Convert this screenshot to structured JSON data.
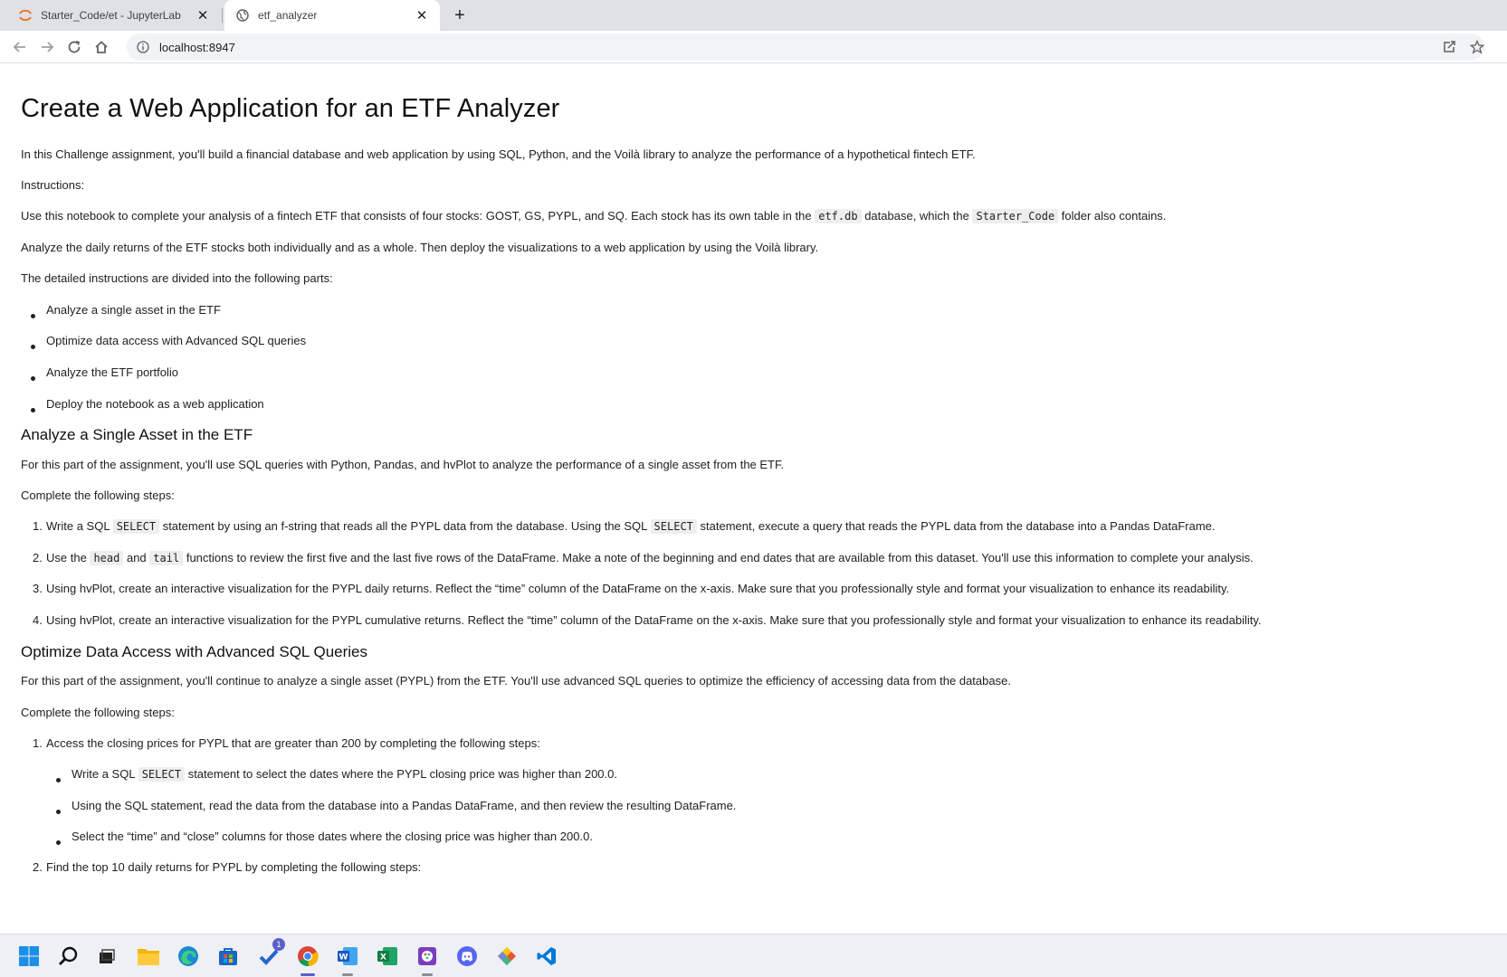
{
  "browser": {
    "tabs": [
      {
        "title": "Starter_Code/et - JupyterLab",
        "active": false,
        "icon": "jupyter-icon"
      },
      {
        "title": "etf_analyzer",
        "active": true,
        "icon": "globe-icon"
      }
    ],
    "url": "localhost:8947"
  },
  "doc": {
    "title": "Create a Web Application for an ETF Analyzer",
    "intro": "In this Challenge assignment, you'll build a financial database and web application by using SQL, Python, and the Voilà library to analyze the performance of a hypothetical fintech ETF.",
    "instructions_label": "Instructions:",
    "use_notebook": {
      "before": "Use this notebook to complete your analysis of a fintech ETF that consists of four stocks: GOST, GS, PYPL, and SQ. Each stock has its own table in the",
      "code1": "etf.db",
      "middle": "database, which the",
      "code2": "Starter_Code",
      "after": "folder also contains."
    },
    "analyze_daily": "Analyze the daily returns of the ETF stocks both individually and as a whole. Then deploy the visualizations to a web application by using the Voilà library.",
    "parts_label": "The detailed instructions are divided into the following parts:",
    "parts": [
      "Analyze a single asset in the ETF",
      "Optimize data access with Advanced SQL queries",
      "Analyze the ETF portfolio",
      "Deploy the notebook as a web application"
    ],
    "section1": {
      "heading": "Analyze a Single Asset in the ETF",
      "intro": "For this part of the assignment, you'll use SQL queries with Python, Pandas, and hvPlot to analyze the performance of a single asset from the ETF.",
      "steps_label": "Complete the following steps:",
      "step1": {
        "num": "1.",
        "a": "Write a SQL",
        "code1": "SELECT",
        "b": "statement by using an f-string that reads all the PYPL data from the database. Using the SQL",
        "code2": "SELECT",
        "c": "statement, execute a query that reads the PYPL data from the database into a Pandas DataFrame."
      },
      "step2": {
        "num": "2.",
        "a": "Use the",
        "code1": "head",
        "b": "and",
        "code2": "tail",
        "c": "functions to review the first five and the last five rows of the DataFrame. Make a note of the beginning and end dates that are available from this dataset. You'll use this information to complete your analysis."
      },
      "step3": {
        "num": "3.",
        "text": "Using hvPlot, create an interactive visualization for the PYPL daily returns. Reflect the “time” column of the DataFrame on the x-axis. Make sure that you professionally style and format your visualization to enhance its readability."
      },
      "step4": {
        "num": "4.",
        "text": "Using hvPlot, create an interactive visualization for the PYPL cumulative returns. Reflect the “time” column of the DataFrame on the x-axis. Make sure that you professionally style and format your visualization to enhance its readability."
      }
    },
    "section2": {
      "heading": "Optimize Data Access with Advanced SQL Queries",
      "intro": "For this part of the assignment, you'll continue to analyze a single asset (PYPL) from the ETF. You'll use advanced SQL queries to optimize the efficiency of accessing data from the database.",
      "steps_label": "Complete the following steps:",
      "step1": {
        "num": "1.",
        "text": "Access the closing prices for PYPL that are greater than 200 by completing the following steps:",
        "sub1": {
          "a": "Write a SQL",
          "code": "SELECT",
          "b": "statement to select the dates where the PYPL closing price was higher than 200.0."
        },
        "sub2": "Using the SQL statement, read the data from the database into a Pandas DataFrame, and then review the resulting DataFrame.",
        "sub3": "Select the “time” and “close” columns for those dates where the closing price was higher than 200.0."
      },
      "step2": {
        "num": "2.",
        "text": "Find the top 10 daily returns for PYPL by completing the following steps:"
      }
    }
  },
  "taskbar": {
    "icons": [
      "windows-start-icon",
      "search-icon",
      "task-view-icon",
      "file-explorer-icon",
      "edge-icon",
      "store-icon",
      "todo-icon",
      "chrome-icon",
      "word-icon",
      "excel-icon",
      "paint-icon",
      "discord-icon",
      "git-icon",
      "vscode-icon"
    ],
    "todo_badge": "1"
  },
  "colors": {
    "tabstrip": "#dee1e6",
    "omnibox": "#f1f3f4",
    "taskbar": "#eef0f5",
    "text": "#212121"
  }
}
